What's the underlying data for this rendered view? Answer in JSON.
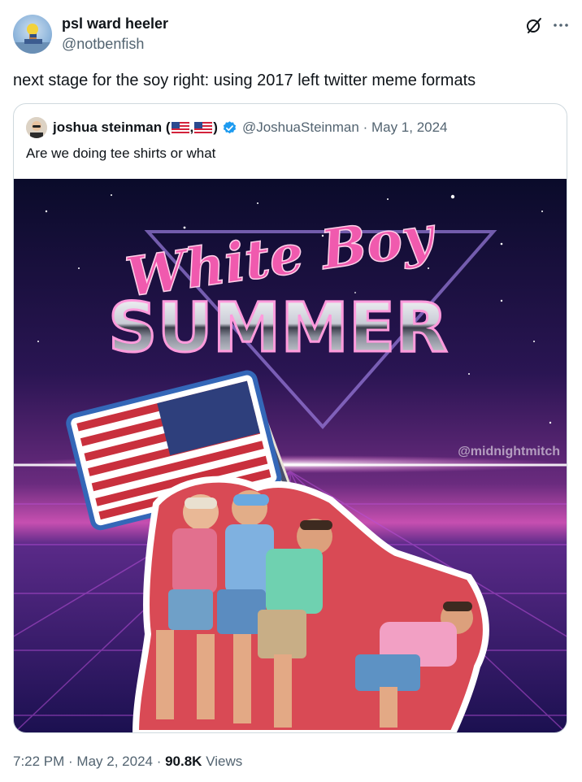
{
  "tweet": {
    "author": {
      "name": "psl ward heeler",
      "handle": "@notbenfish"
    },
    "text": "next stage for the soy right: using 2017 left twitter meme formats",
    "icons": {
      "grok": "grok-slash-icon",
      "more": "more-dots-icon"
    }
  },
  "quote": {
    "author": {
      "name": "joshua steinman (",
      "name_sep": ",",
      "name_close": ")",
      "handle": "@JoshuaSteinman",
      "date": "May 1, 2024"
    },
    "flags": [
      "us-flag-icon",
      "us-flag-icon"
    ],
    "verified_icon": "verified-badge-icon",
    "text": "Are we doing tee shirts or what",
    "image": {
      "title_script": "White Boy",
      "title_main": "SUMMER",
      "watermark": "@midnightmitch"
    }
  },
  "footer": {
    "time": "7:22 PM",
    "date": "May 2, 2024",
    "views": "90.8K",
    "views_label": "Views"
  },
  "colors": {
    "text": "#0f1419",
    "secondary": "#536471",
    "border": "#cfd9de",
    "verified": "#1d9bf0",
    "neon_pink": "#e0489e"
  }
}
